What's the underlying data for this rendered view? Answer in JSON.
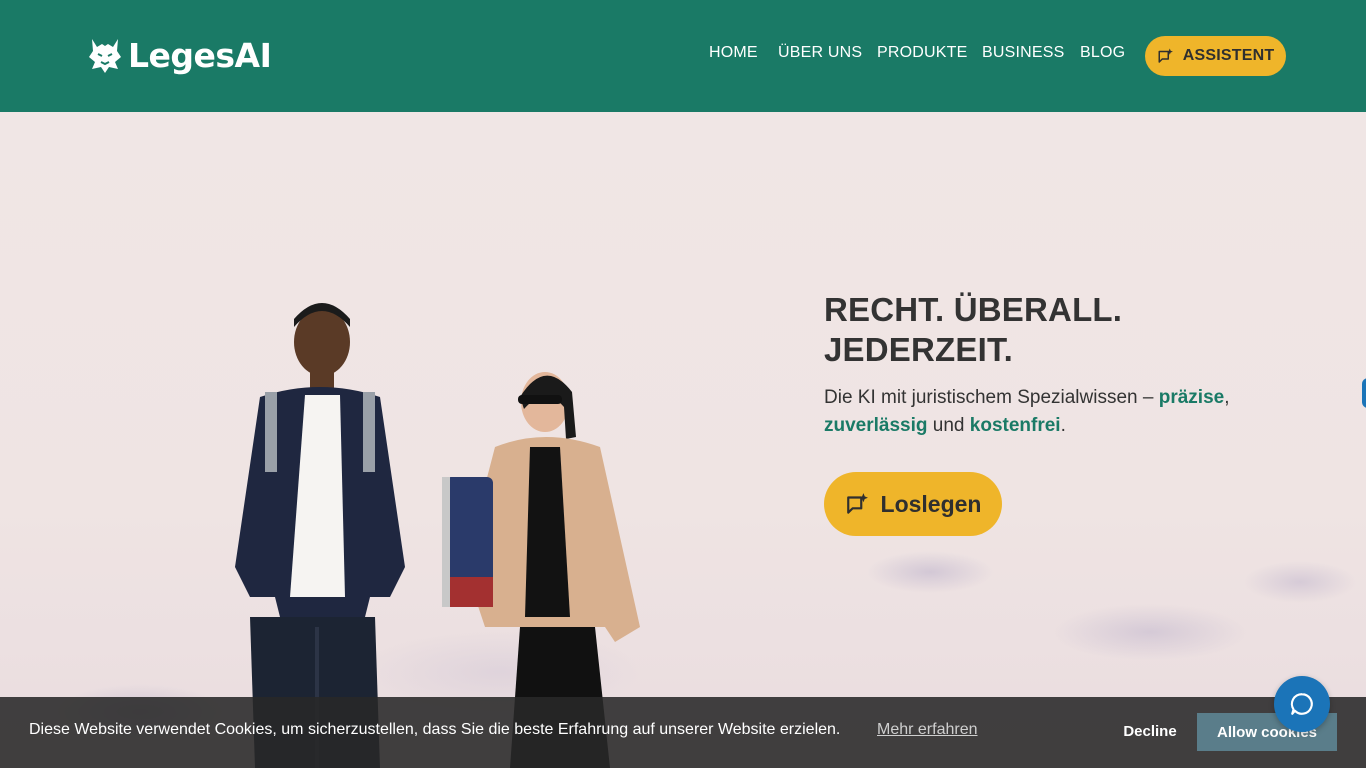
{
  "brand": {
    "name": "LegesAI",
    "icon": "lynx-logo-icon"
  },
  "nav": {
    "items": [
      {
        "label": "HOME"
      },
      {
        "label": "ÜBER UNS"
      },
      {
        "label": "PRODUKTE"
      },
      {
        "label": "BUSINESS"
      },
      {
        "label": "BLOG"
      }
    ],
    "cta_label": "ASSISTENT",
    "cta_icon": "sparkle-chat-icon"
  },
  "hero": {
    "title_line1": "RECHT. ÜBERALL.",
    "title_line2": "JEDERZEIT.",
    "text_part1": "Die KI mit juristischem Spezialwissen – ",
    "hl1": "präzise",
    "text_part2": ",",
    "hl2": "zuverlässig",
    "text_part3": " und ",
    "hl3": "kostenfrei",
    "text_part4": ".",
    "button_label": "Loslegen",
    "button_icon": "sparkle-chat-icon",
    "image": "two-people-in-front-of-wall-photo"
  },
  "cookie": {
    "text": "Diese Website verwendet Cookies, um sicherzustellen, dass Sie die beste Erfahrung auf unserer Website erzielen.",
    "link": "Mehr erfahren",
    "decline": "Decline",
    "allow": "Allow cookies"
  },
  "chat": {
    "icon": "chat-bubble-icon"
  },
  "colors": {
    "primary": "#1a7a66",
    "accent": "#efb52a",
    "text": "#333333",
    "chat": "#1b74b8"
  }
}
